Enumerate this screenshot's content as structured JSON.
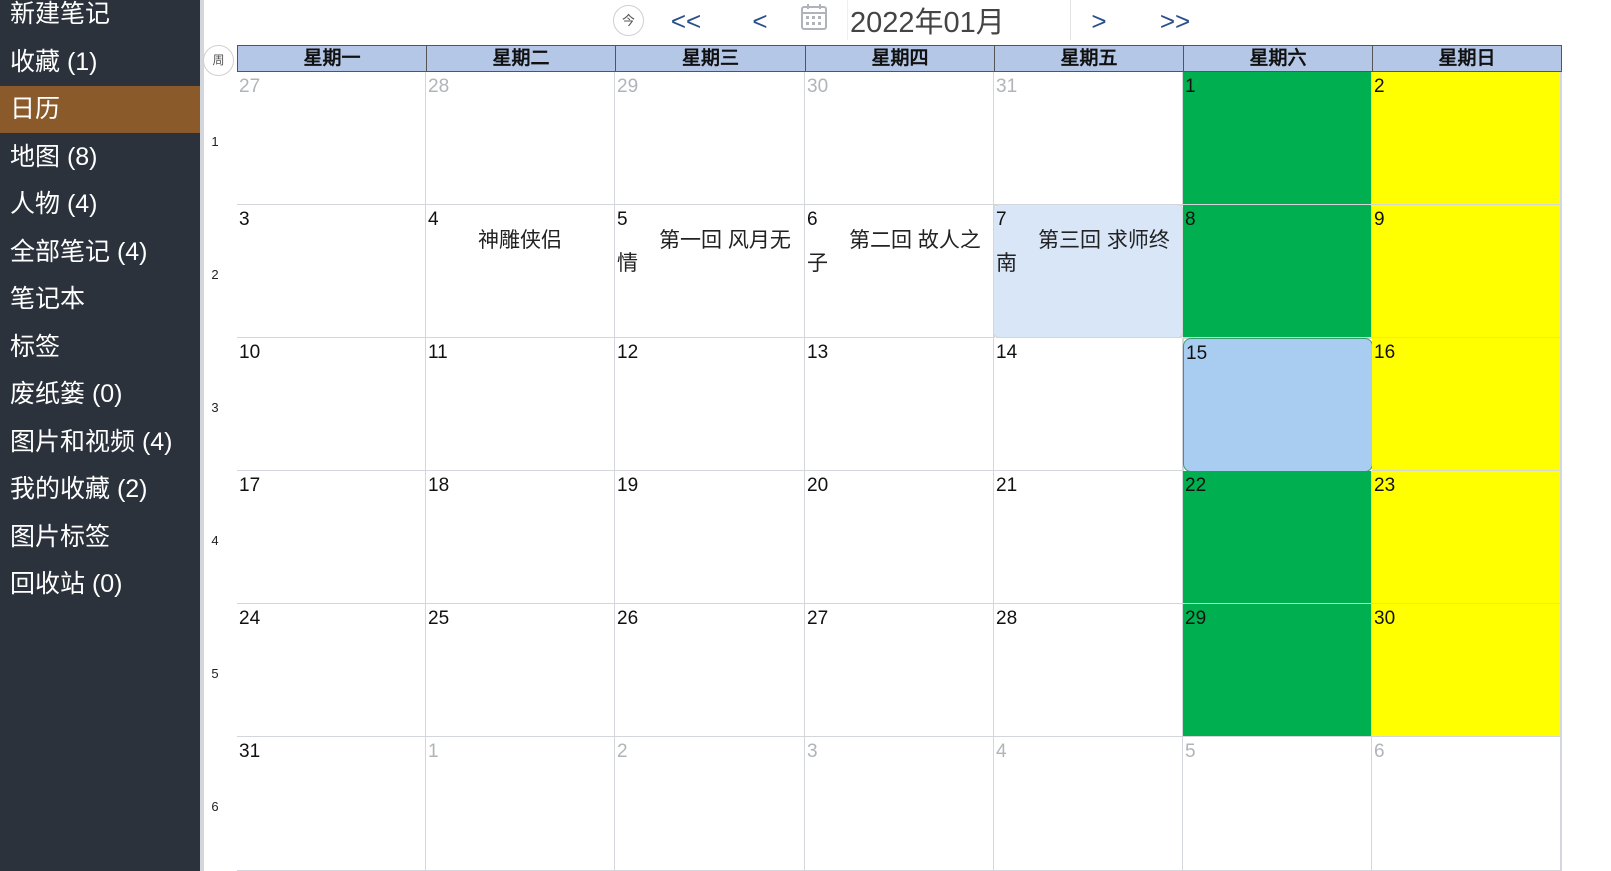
{
  "sidebar": {
    "items": [
      {
        "label": "新建笔记"
      },
      {
        "label": "收藏 (1)"
      },
      {
        "label": "日历",
        "active": true
      },
      {
        "label": "地图 (8)"
      },
      {
        "label": "人物 (4)"
      },
      {
        "label": "全部笔记 (4)"
      },
      {
        "label": "笔记本"
      },
      {
        "label": "标签"
      },
      {
        "label": "废纸篓 (0)"
      },
      {
        "label": "图片和视频 (4)"
      },
      {
        "label": "我的收藏 (2)"
      },
      {
        "label": "图片标签"
      },
      {
        "label": "回收站 (0)"
      }
    ]
  },
  "toolbar": {
    "today_label": "今",
    "prev_year": "<<",
    "prev_month": "<",
    "month_value": "2022年01月",
    "next_month": ">",
    "next_year": ">>"
  },
  "calendar": {
    "week_header": "周",
    "weekdays": [
      "星期一",
      "星期二",
      "星期三",
      "星期四",
      "星期五",
      "星期六",
      "星期日"
    ],
    "weeks": [
      {
        "num": "1",
        "days": [
          {
            "d": "27",
            "other": true
          },
          {
            "d": "28",
            "other": true
          },
          {
            "d": "29",
            "other": true
          },
          {
            "d": "30",
            "other": true
          },
          {
            "d": "31",
            "other": true
          },
          {
            "d": "1",
            "bg": "green"
          },
          {
            "d": "2",
            "bg": "yellow"
          }
        ]
      },
      {
        "num": "2",
        "days": [
          {
            "d": "3"
          },
          {
            "d": "4",
            "event": "神雕侠侣",
            "center": true
          },
          {
            "d": "5",
            "event": "第一回 风月无情"
          },
          {
            "d": "6",
            "event": "第二回 故人之子"
          },
          {
            "d": "7",
            "event": "第三回 求师终南",
            "bg": "event"
          },
          {
            "d": "8",
            "bg": "green"
          },
          {
            "d": "9",
            "bg": "yellow"
          }
        ]
      },
      {
        "num": "3",
        "days": [
          {
            "d": "10"
          },
          {
            "d": "11"
          },
          {
            "d": "12"
          },
          {
            "d": "13"
          },
          {
            "d": "14"
          },
          {
            "d": "15",
            "bg": "today"
          },
          {
            "d": "16",
            "bg": "yellow"
          }
        ]
      },
      {
        "num": "4",
        "days": [
          {
            "d": "17"
          },
          {
            "d": "18"
          },
          {
            "d": "19"
          },
          {
            "d": "20"
          },
          {
            "d": "21"
          },
          {
            "d": "22",
            "bg": "green"
          },
          {
            "d": "23",
            "bg": "yellow"
          }
        ]
      },
      {
        "num": "5",
        "days": [
          {
            "d": "24"
          },
          {
            "d": "25"
          },
          {
            "d": "26"
          },
          {
            "d": "27"
          },
          {
            "d": "28"
          },
          {
            "d": "29",
            "bg": "green"
          },
          {
            "d": "30",
            "bg": "yellow"
          }
        ]
      },
      {
        "num": "6",
        "days": [
          {
            "d": "31"
          },
          {
            "d": "1",
            "other": true
          },
          {
            "d": "2",
            "other": true
          },
          {
            "d": "3",
            "other": true
          },
          {
            "d": "4",
            "other": true
          },
          {
            "d": "5",
            "other": true
          },
          {
            "d": "6",
            "other": true
          }
        ]
      }
    ]
  },
  "colors": {
    "sidebar_bg": "#2b323c",
    "active_item": "#8b5a2b",
    "header_bg": "#b4c7e7",
    "saturday": "#00b050",
    "sunday": "#ffff00",
    "today": "#a9cdf1",
    "event_bg": "#d8e6f8"
  }
}
